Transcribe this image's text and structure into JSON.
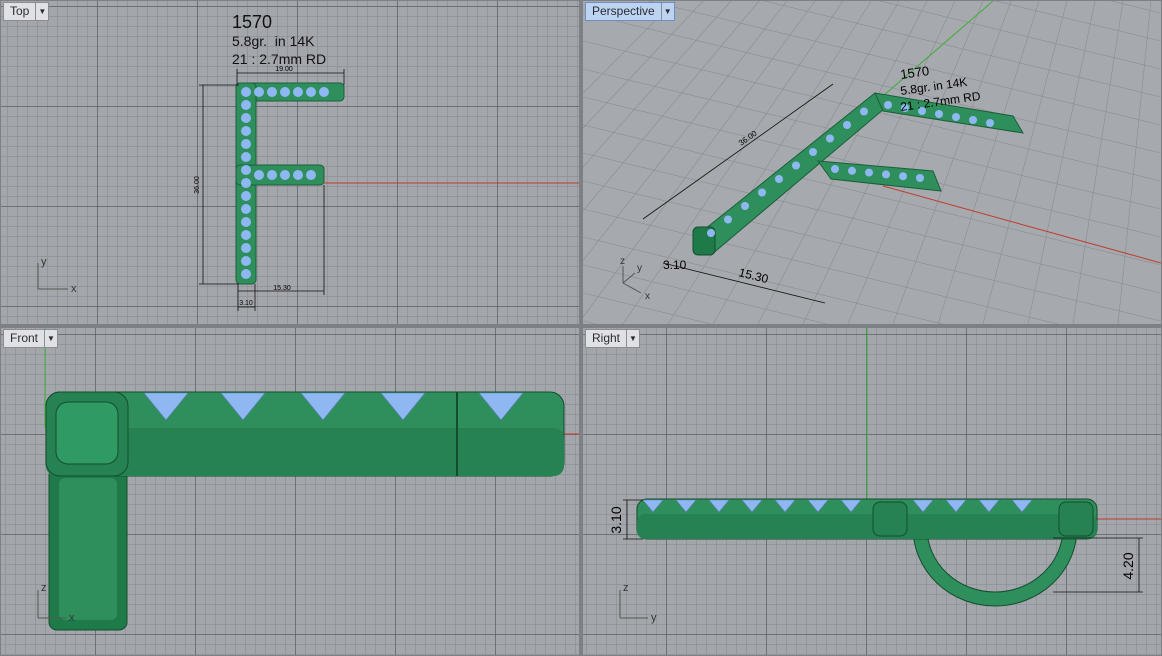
{
  "viewports": {
    "top": {
      "label": "Top"
    },
    "perspective": {
      "label": "Perspective"
    },
    "front": {
      "label": "Front"
    },
    "right": {
      "label": "Right"
    }
  },
  "annotation": {
    "model_number": "1570",
    "weight": "5.8gr.  in 14K",
    "stones": "21 : 2.7mm RD"
  },
  "dimensions": {
    "width": "19.00",
    "height": "36.00",
    "thickness": "3.10",
    "middle_bar": "15.30",
    "bail": "4.20"
  },
  "axes": {
    "x": "x",
    "y": "y",
    "z": "z"
  },
  "colors": {
    "metal": "#2f8f5c",
    "metal_dark": "#1b6a3f",
    "stone": "#8fb8f2",
    "x_axis": "#c0392b",
    "y_axis": "#3fae3a",
    "viewport_bg": "#a3a6ab"
  }
}
